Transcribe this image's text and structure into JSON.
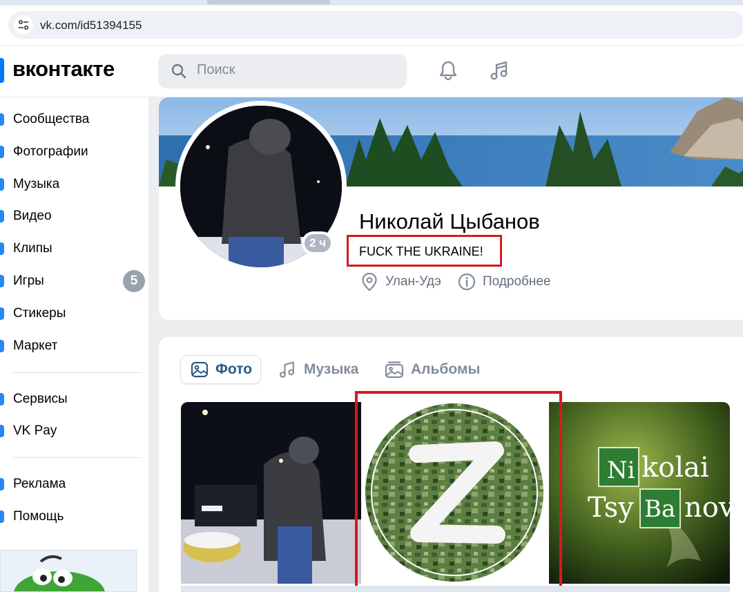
{
  "browser": {
    "url": "vk.com/id51394155"
  },
  "header": {
    "logo": "вконтакте",
    "search_placeholder": "Поиск"
  },
  "sidebar": {
    "items": [
      {
        "label": "Сообщества"
      },
      {
        "label": "Фотографии"
      },
      {
        "label": "Музыка"
      },
      {
        "label": "Видео"
      },
      {
        "label": "Клипы"
      },
      {
        "label": "Игры",
        "badge": "5"
      },
      {
        "label": "Стикеры"
      },
      {
        "label": "Маркет"
      },
      {
        "label": "Сервисы"
      },
      {
        "label": "VK Pay"
      },
      {
        "label": "Реклама"
      },
      {
        "label": "Помощь"
      }
    ]
  },
  "profile": {
    "name": "Николай Цыбанов",
    "status": "FUCK THE UKRAINE!",
    "last_seen": "2 ч",
    "city": "Улан-Удэ",
    "more": "Подробнее"
  },
  "media_tabs": {
    "photo": "Фото",
    "music": "Музыка",
    "albums": "Альбомы"
  },
  "photos": {
    "third_line1_cell1": "Ni",
    "third_line1_rest": "kolai",
    "third_line2_start": "Tsy",
    "third_line2_cell": "Ba",
    "third_line2_rest": "nov"
  },
  "colors": {
    "accent": "#0077ff",
    "link": "#2a5885",
    "highlight_box": "#d7181f"
  }
}
